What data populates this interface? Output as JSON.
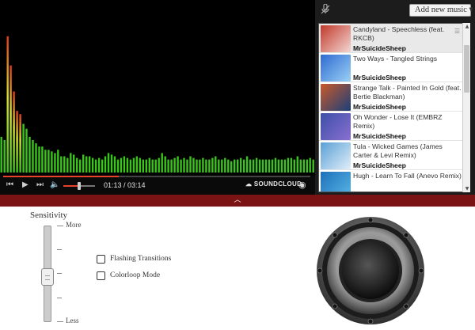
{
  "player": {
    "time_display": "01:13 / 03:14",
    "soundcloud_label": "SOUNDCLOUD",
    "progress": 0.376,
    "volume": 0.5,
    "accent_color": "#e8412c"
  },
  "visualizer": {
    "bar_color_base": "#39c51a",
    "bar_color_mid": "#d9e628",
    "bar_color_peak": "#e23a1a",
    "levels": [
      0.22,
      0.2,
      0.84,
      0.66,
      0.5,
      0.38,
      0.36,
      0.3,
      0.27,
      0.22,
      0.2,
      0.18,
      0.16,
      0.16,
      0.14,
      0.14,
      0.13,
      0.12,
      0.14,
      0.1,
      0.1,
      0.09,
      0.12,
      0.11,
      0.09,
      0.08,
      0.11,
      0.1,
      0.1,
      0.09,
      0.08,
      0.09,
      0.08,
      0.1,
      0.12,
      0.11,
      0.1,
      0.08,
      0.09,
      0.1,
      0.09,
      0.08,
      0.09,
      0.1,
      0.09,
      0.08,
      0.08,
      0.09,
      0.08,
      0.08,
      0.09,
      0.12,
      0.1,
      0.08,
      0.08,
      0.09,
      0.1,
      0.08,
      0.09,
      0.08,
      0.1,
      0.09,
      0.08,
      0.08,
      0.09,
      0.08,
      0.08,
      0.09,
      0.1,
      0.08,
      0.08,
      0.09,
      0.08,
      0.07,
      0.08,
      0.08,
      0.09,
      0.08,
      0.1,
      0.08,
      0.08,
      0.09,
      0.08,
      0.08,
      0.08,
      0.08,
      0.08,
      0.09,
      0.08,
      0.08,
      0.08,
      0.09,
      0.09,
      0.08,
      0.1,
      0.08,
      0.08,
      0.08,
      0.09,
      0.08
    ]
  },
  "toolbar": {
    "add_button_label": "Add new music ▾"
  },
  "playlist": {
    "tracks": [
      {
        "title": "Candyland - Speechless (feat. RKCB)",
        "artist": "MrSuicideSheep",
        "active": true,
        "thumb": [
          "#c0392b",
          "#f4d7d2"
        ]
      },
      {
        "title": "Two Ways - Tangled Strings",
        "artist": "MrSuicideSheep",
        "active": false,
        "thumb": [
          "#2f6bd1",
          "#9ad0f5"
        ]
      },
      {
        "title": "Strange Talk - Painted In Gold (feat. Bertie Blackman)",
        "artist": "MrSuicideSheep",
        "active": false,
        "thumb": [
          "#c85a2a",
          "#1c3f7a"
        ]
      },
      {
        "title": "Oh Wonder - Lose It (EMBRZ Remix)",
        "artist": "MrSuicideSheep",
        "active": false,
        "thumb": [
          "#3b4fa8",
          "#8a6fd0"
        ]
      },
      {
        "title": "Tula - Wicked Games (James Carter & Levi Remix)",
        "artist": "MrSuicideSheep",
        "active": false,
        "thumb": [
          "#5aa0d6",
          "#e1eef8"
        ]
      },
      {
        "title": "Hugh - Learn To Fall (Anevo Remix)",
        "artist": "",
        "active": false,
        "thumb": [
          "#1e6fb8",
          "#58b9e8"
        ]
      }
    ]
  },
  "settings": {
    "sensitivity_title": "Sensitivity",
    "more_label": "More",
    "less_label": "Less",
    "sensitivity_value": 0.35,
    "flashing_label": "Flashing Transitions",
    "colorloop_label": "Colorloop Mode",
    "flashing_checked": false,
    "colorloop_checked": false
  }
}
